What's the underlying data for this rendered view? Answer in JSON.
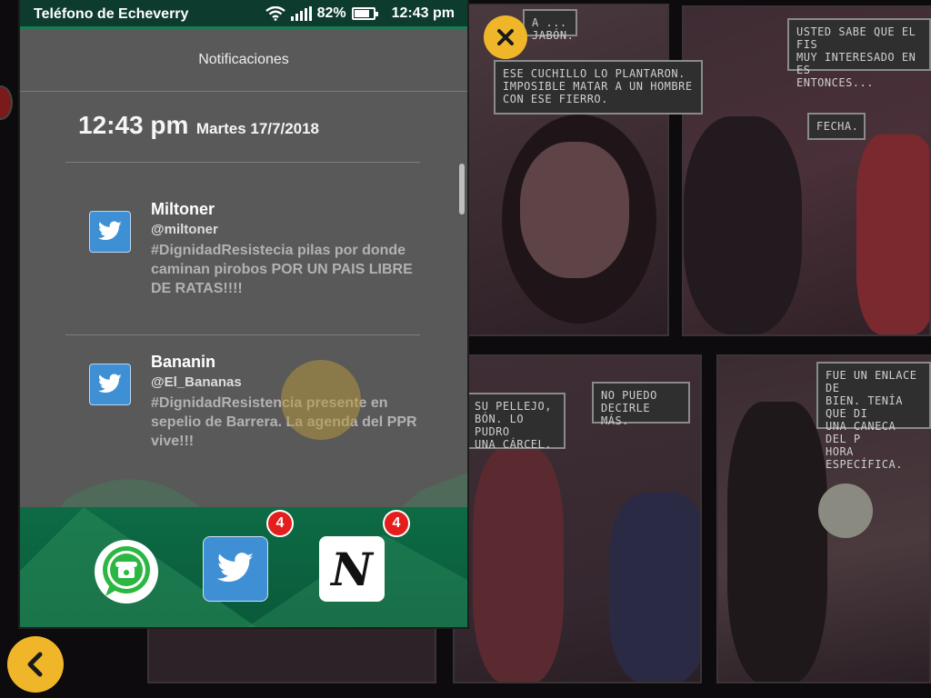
{
  "phone": {
    "status_title": "Teléfono de Echeverry",
    "battery": "82%",
    "time": "12:43 pm",
    "notifications_title": "Notificaciones",
    "clock_time": "12:43 pm",
    "clock_date": "Martes 17/7/2018",
    "notifications": [
      {
        "name": "Miltoner",
        "handle": "@miltoner",
        "message": "#DignidadResistecia pilas por donde caminan pirobos POR UN PAIS LIBRE DE RATAS!!!!",
        "icon": "twitter-icon"
      },
      {
        "name": "Bananin",
        "handle": "@El_Bananas",
        "message": "#DignidadResistencia presente en sepelio de Barrera. La agenda del PPR vive!!!",
        "icon": "twitter-icon"
      }
    ],
    "dock": {
      "whatsapp_icon": "phone-chat-icon",
      "twitter_badge": "4",
      "news_badge": "4",
      "news_letter": "N"
    }
  },
  "comic": {
    "bubbles": [
      "A ... JABÓN.",
      "ESE CUCHILLO LO PLANTARON.\nIMPOSIBLE MATAR A UN HOMBRE\nCON ESE FIERRO.",
      "USTED SABE QUE EL FIS\nMUY INTERESADO EN ES\nENTONCES...",
      "FECHA.",
      "SU PELLEJO,\nBÓN. LO PUDRO\nUNA CÁRCEL.",
      "NO PUEDO\nDECIRLE MÁS.",
      "FUE UN ENLACE DE\nBIEN. TENÍA QUE DI\nUNA CANECA DEL P\nHORA ESPECÍFICA."
    ]
  },
  "colors": {
    "accent_yellow": "#f0b62a",
    "status_green": "#0d3b2e",
    "dock_green": "#0d6b45",
    "badge_red": "#e41d1d",
    "twitter_blue": "#3e8fd4"
  }
}
